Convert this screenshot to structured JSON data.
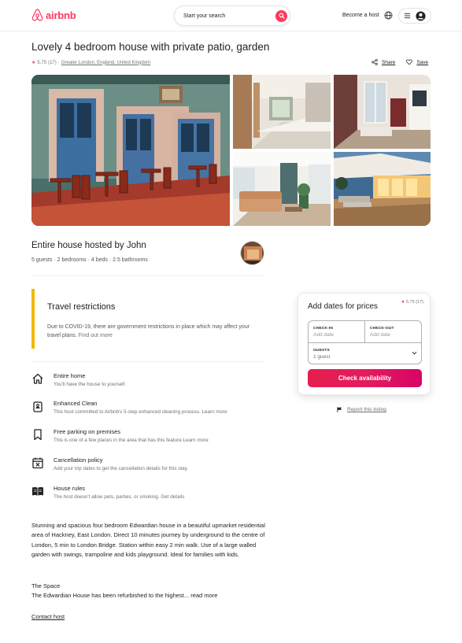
{
  "header": {
    "logo_text": "airbnb",
    "search_placeholder": "Start your search",
    "become_host": "Become a host"
  },
  "listing": {
    "title": "Lovely 4 bedroom house with private patio, garden",
    "rating": "5.75",
    "reviews": "(17)",
    "separator": "·",
    "location": "Greater London, England, United Kingdom",
    "share_label": "Share",
    "save_label": "Save"
  },
  "host": {
    "title": "Entire house hosted by John",
    "summary": "5 guests · 2 bedrooms · 4 beds · 2.5 bathrooms"
  },
  "travel": {
    "title": "Travel restrictions",
    "text": "Due to COVID-19, there are government restrictions in place which may affect your travel plans.",
    "link": "Find out more"
  },
  "features": [
    {
      "title": "Entire home",
      "desc": "You'll have the house to yourself."
    },
    {
      "title": "Enhanced Clean",
      "desc": "This host committed to Airbnb's 5-step enhanced cleaning process. Learn more"
    },
    {
      "title": "Free parking on premises",
      "desc": "This is one of a few places in the area that has this feature.Learn more"
    },
    {
      "title": "Cancellation policy",
      "desc": "Add your trip dates to get the cancellation details for this stay."
    },
    {
      "title": "House rules",
      "desc": "The host doesn't allow pets, parties, or smoking. Get details"
    }
  ],
  "description": {
    "body": "Stunning and spacious four bedroom Edwardian house in a beautiful upmarket residential area of Hackney, East London. Direct 10 minutes journey by underground to the centre of London, 5 min to London Bridge. Station within easy 2 min walk. Use of a large walled garden with swings, trampoline and kids playground. Ideal for families with kids.",
    "space_title": "The Space",
    "space_text": "The Edwardian House has been refurbished to the highest... read more",
    "contact": "Contact host"
  },
  "booking": {
    "title": "Add dates for prices",
    "rating": "5.75",
    "reviews": "(17)",
    "checkin_label": "CHECK-IN",
    "checkin_value": "Add date",
    "checkout_label": "CHECK-OUT",
    "checkout_value": "Add date",
    "guests_label": "GUESTS",
    "guests_value": "1 guest",
    "button": "Check availability",
    "report": "Report this listing"
  },
  "colors": {
    "brand": "#ff385c",
    "travel_accent": "#f2b800"
  }
}
